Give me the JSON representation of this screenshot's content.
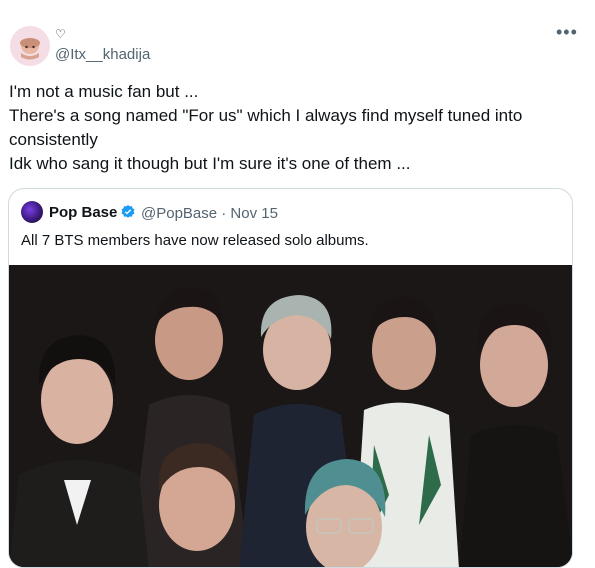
{
  "author": {
    "display_name": "♡",
    "handle": "@Itx__khadija",
    "avatar_icon": "cartoon-avatar-icon",
    "avatar_color": "#f4dde4"
  },
  "more_label": "•••",
  "tweet_lines": [
    "I'm not a music fan but ...",
    "There's a song named \"For us\" which I always find myself tuned into",
    "consistently",
    "Idk who sang it though but I'm sure it's one of them ..."
  ],
  "quote": {
    "name": "Pop Base",
    "verified_icon": "verified-badge-icon",
    "verified_color": "#1d9bf0",
    "handle": "@PopBase",
    "separator": "·",
    "date": "Nov 15",
    "meta": "@PopBase · Nov 15",
    "text": "All 7 BTS members have now released solo albums."
  },
  "colors": {
    "text": "#0f1419",
    "secondary": "#536471",
    "border": "#cfd9de"
  }
}
